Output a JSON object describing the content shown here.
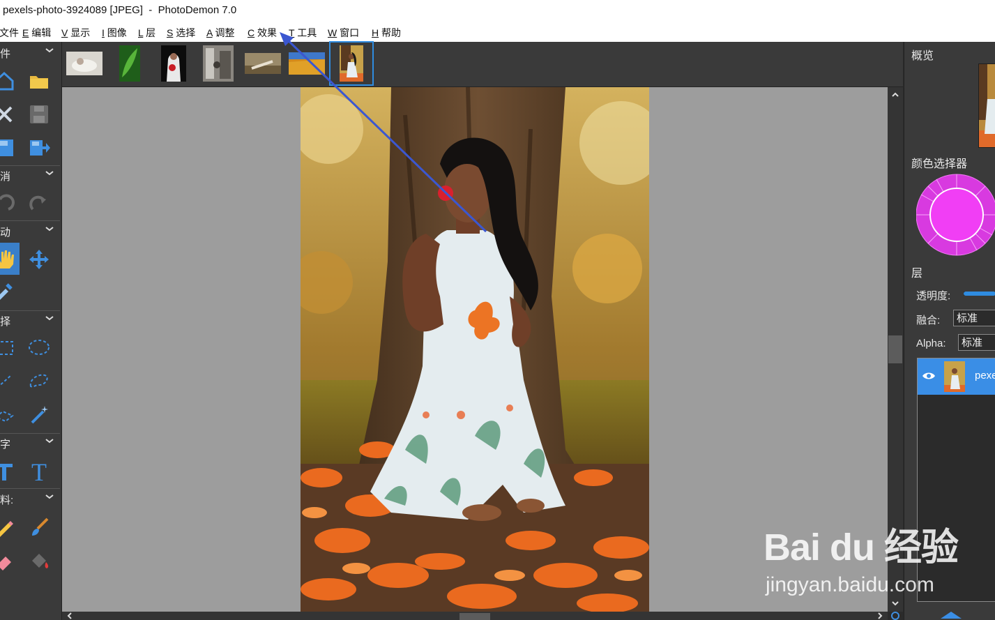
{
  "window": {
    "title": "pexels-photo-3924089 [JPEG]  -  PhotoDemon 7.0"
  },
  "menu": [
    {
      "key": "",
      "label": "文件"
    },
    {
      "key": "E",
      "label": "编辑"
    },
    {
      "key": "V",
      "label": "显示"
    },
    {
      "key": "I",
      "label": "图像"
    },
    {
      "key": "L",
      "label": "层"
    },
    {
      "key": "S",
      "label": "选择"
    },
    {
      "key": "A",
      "label": "调整"
    },
    {
      "key": "C",
      "label": "效果"
    },
    {
      "key": "T",
      "label": "工具"
    },
    {
      "key": "W",
      "label": "窗口"
    },
    {
      "key": "H",
      "label": "帮助"
    }
  ],
  "toolbox": {
    "sections": [
      "件",
      "消",
      "动",
      "择",
      "字",
      "料:"
    ]
  },
  "thumbnails": {
    "count": 7,
    "selected_index": 6
  },
  "right_panel": {
    "overview_title": "概览",
    "color_picker_title": "颜色选择器",
    "layers_title": "层",
    "opacity_label": "透明度:",
    "blend_label": "融合:",
    "blend_value": "标准",
    "alpha_label": "Alpha:",
    "alpha_value": "标准",
    "layer_name": "pexe",
    "opacity_level": 1.0
  },
  "colors": {
    "accent": "#3a8ee6",
    "picker_color": "#f13ef5",
    "annotation_arrow": "#3b57d1"
  },
  "watermark": {
    "brand": "Bai du 经验",
    "url": "jingyan.baidu.com"
  }
}
